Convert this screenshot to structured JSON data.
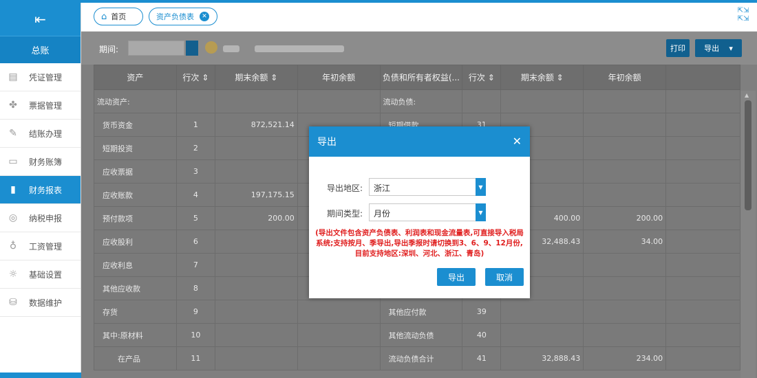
{
  "sidebar": {
    "toggle_icon": "collapse-menu-icon",
    "title": "总账",
    "items": [
      {
        "label": "凭证管理",
        "icon": "voucher-icon",
        "glyph": "▤"
      },
      {
        "label": "票据管理",
        "icon": "ticket-icon",
        "glyph": "✤"
      },
      {
        "label": "结账办理",
        "icon": "pencil-icon",
        "glyph": "✎"
      },
      {
        "label": "财务账簿",
        "icon": "book-icon",
        "glyph": "▭"
      },
      {
        "label": "财务报表",
        "icon": "bar-chart-icon",
        "glyph": "▮"
      },
      {
        "label": "纳税申报",
        "icon": "tax-icon",
        "glyph": "◎"
      },
      {
        "label": "工资管理",
        "icon": "money-bag-icon",
        "glyph": "♁"
      },
      {
        "label": "基础设置",
        "icon": "settings-icon",
        "glyph": "☼"
      },
      {
        "label": "数据维护",
        "icon": "database-icon",
        "glyph": "⛁"
      }
    ]
  },
  "tabs": {
    "home": "首页",
    "sheet": "资产负债表"
  },
  "toolbar": {
    "period_label": "期间:",
    "print": "打印",
    "export": "导出"
  },
  "table": {
    "headers": [
      "资产",
      "行次 ⇕",
      "期末余额 ⇕",
      "年初余额",
      "负债和所有者权益(...",
      "行次 ⇕",
      "期末余额 ⇕",
      "年初余额"
    ],
    "rows": [
      [
        "流动资产:",
        "",
        "",
        "",
        "流动负债:",
        "",
        "",
        ""
      ],
      [
        "货币资金",
        "1",
        "872,521.14",
        "",
        "短期借款",
        "31",
        "",
        ""
      ],
      [
        "短期投资",
        "2",
        "",
        "",
        "",
        "",
        "",
        ""
      ],
      [
        "应收票据",
        "3",
        "",
        "",
        "",
        "",
        "",
        ""
      ],
      [
        "应收账款",
        "4",
        "197,175.15",
        "",
        "",
        "",
        "",
        ""
      ],
      [
        "预付款项",
        "5",
        "200.00",
        "",
        "",
        "",
        "400.00",
        "200.00"
      ],
      [
        "应收股利",
        "6",
        "",
        "",
        "",
        "",
        "32,488.43",
        "34.00"
      ],
      [
        "应收利息",
        "7",
        "",
        "",
        "",
        "",
        "",
        ""
      ],
      [
        "其他应收款",
        "8",
        "",
        "",
        "",
        "",
        "",
        ""
      ],
      [
        "存货",
        "9",
        "",
        "",
        "其他应付款",
        "39",
        "",
        ""
      ],
      [
        "其中:原材料",
        "10",
        "",
        "",
        "其他流动负债",
        "40",
        "",
        ""
      ],
      [
        "在产品",
        "11",
        "",
        "",
        "流动负债合计",
        "41",
        "32,888.43",
        "234.00"
      ]
    ]
  },
  "modal": {
    "title": "导出",
    "region_label": "导出地区:",
    "region_value": "浙江",
    "period_type_label": "期间类型:",
    "period_type_value": "月份",
    "note": "(导出文件包含资产负债表、利润表和现金流量表,可直接导入税局系统;支持按月、季导出,导出季报时请切换到3、6、9、12月份,目前支持地区:深圳、河北、浙江、青岛)",
    "ok": "导出",
    "cancel": "取消"
  }
}
